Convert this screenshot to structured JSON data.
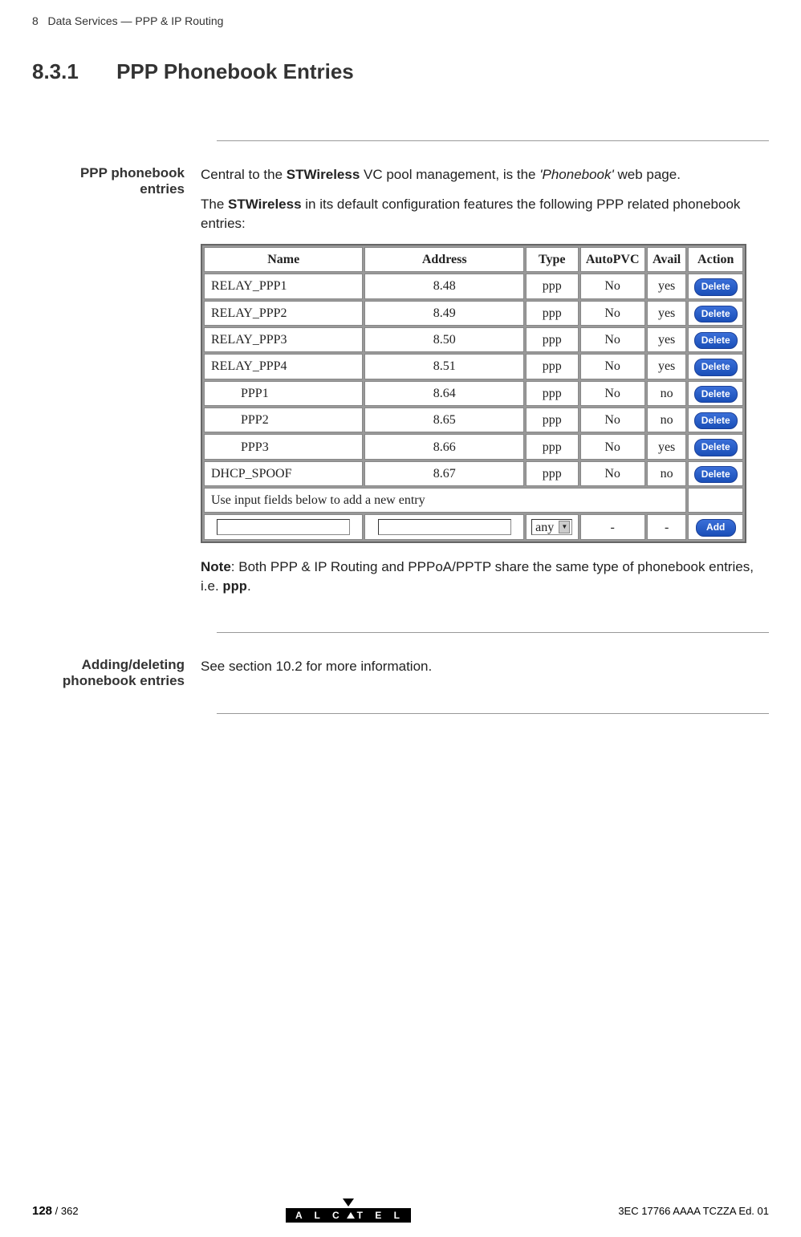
{
  "header": {
    "chapter_num": "8",
    "chapter_title": "Data Services — PPP & IP Routing"
  },
  "section": {
    "number": "8.3.1",
    "title": "PPP Phonebook Entries"
  },
  "block1": {
    "label": "PPP phonebook entries",
    "p1_pre": "Central to the ",
    "p1_bold": "STWireless",
    "p1_mid": " VC pool management, is the ",
    "p1_italic": "'Phonebook'",
    "p1_post": " web page.",
    "p2_pre": "The ",
    "p2_bold": "STWireless",
    "p2_post": " in its default configuration features the following PPP related phonebook entries:",
    "note_label": "Note",
    "note_text": ": Both PPP & IP Routing and PPPoA/PPTP share the same type of phonebook entries, i.e. ",
    "note_mono": "ppp",
    "note_end": "."
  },
  "table": {
    "headers": [
      "Name",
      "Address",
      "Type",
      "AutoPVC",
      "Avail",
      "Action"
    ],
    "rows": [
      {
        "name": "RELAY_PPP1",
        "indent": false,
        "address": "8.48",
        "type": "ppp",
        "autopvc": "No",
        "avail": "yes",
        "action": "Delete"
      },
      {
        "name": "RELAY_PPP2",
        "indent": false,
        "address": "8.49",
        "type": "ppp",
        "autopvc": "No",
        "avail": "yes",
        "action": "Delete"
      },
      {
        "name": "RELAY_PPP3",
        "indent": false,
        "address": "8.50",
        "type": "ppp",
        "autopvc": "No",
        "avail": "yes",
        "action": "Delete"
      },
      {
        "name": "RELAY_PPP4",
        "indent": false,
        "address": "8.51",
        "type": "ppp",
        "autopvc": "No",
        "avail": "yes",
        "action": "Delete"
      },
      {
        "name": "PPP1",
        "indent": true,
        "address": "8.64",
        "type": "ppp",
        "autopvc": "No",
        "avail": "no",
        "action": "Delete"
      },
      {
        "name": "PPP2",
        "indent": true,
        "address": "8.65",
        "type": "ppp",
        "autopvc": "No",
        "avail": "no",
        "action": "Delete"
      },
      {
        "name": "PPP3",
        "indent": true,
        "address": "8.66",
        "type": "ppp",
        "autopvc": "No",
        "avail": "yes",
        "action": "Delete"
      },
      {
        "name": "DHCP_SPOOF",
        "indent": false,
        "address": "8.67",
        "type": "ppp",
        "autopvc": "No",
        "avail": "no",
        "action": "Delete"
      }
    ],
    "hint": "Use input fields below to add a new entry",
    "input_row": {
      "type_value": "any",
      "autopvc": "-",
      "avail": "-",
      "action": "Add"
    }
  },
  "block2": {
    "label": "Adding/deleting phonebook entries",
    "text": "See section 10.2 for more information."
  },
  "footer": {
    "page": "128",
    "total": " / 362",
    "logo": "ALCATEL",
    "docref": "3EC 17766 AAAA TCZZA Ed. 01"
  }
}
